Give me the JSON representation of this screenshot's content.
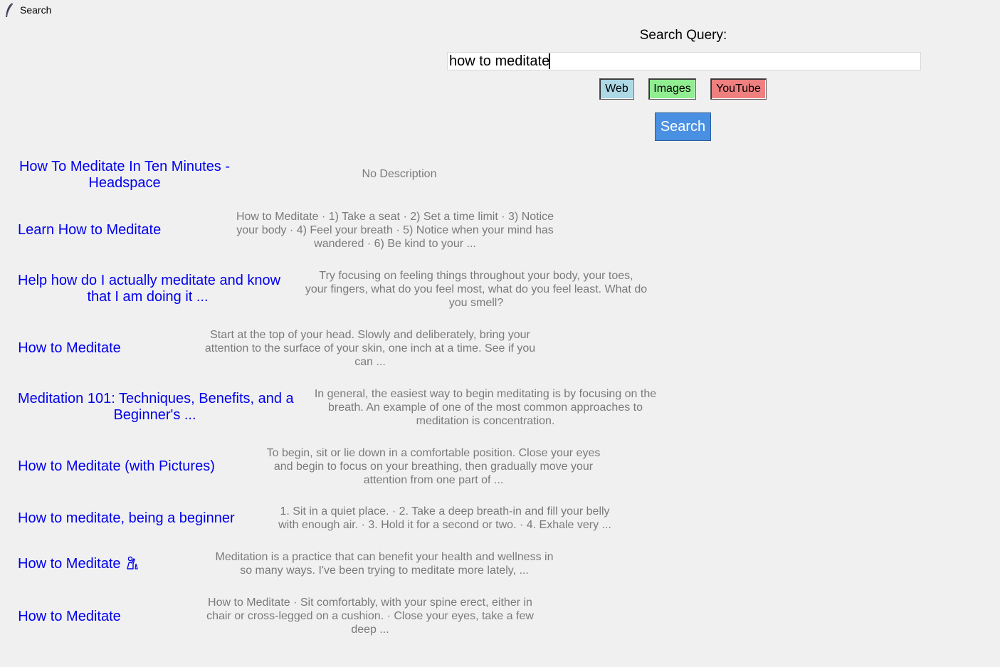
{
  "window": {
    "title": "Search",
    "icon": "feather-icon"
  },
  "search": {
    "label": "Search Query:",
    "value": "how to meditate",
    "search_button": "Search"
  },
  "sources": {
    "web": {
      "label": "Web",
      "color": "#add8e6"
    },
    "images": {
      "label": "Images",
      "color": "#90ee90"
    },
    "youtube": {
      "label": "YouTube",
      "color": "#f08080"
    }
  },
  "colors": {
    "link": "#0000ee",
    "description": "#7a7a7a",
    "search_button": "#4a90e2"
  },
  "results": [
    {
      "title_lines": [
        "How To Meditate In Ten Minutes -",
        "Headspace"
      ],
      "desc_lines": [
        "No Description"
      ]
    },
    {
      "title_lines": [
        "Learn How to Meditate"
      ],
      "desc_lines": [
        "How to Meditate · 1) Take a seat · 2) Set a time limit · 3) Notice",
        "your body · 4) Feel your breath · 5) Notice when your mind has",
        "wandered · 6) Be kind to your ..."
      ]
    },
    {
      "title_lines": [
        "Help how do I actually meditate and know",
        "that I am doing it ..."
      ],
      "desc_lines": [
        "Try focusing on feeling things throughout your body, your toes,",
        "your fingers, what do you feel most, what do you feel least. What do",
        "you smell?"
      ]
    },
    {
      "title_lines": [
        "How to Meditate"
      ],
      "desc_lines": [
        "Start at the top of your head. Slowly and deliberately, bring your",
        "attention to the surface of your skin, one inch at a time. See if you",
        "can ..."
      ]
    },
    {
      "title_lines": [
        "Meditation 101: Techniques, Benefits, and a",
        "Beginner's ..."
      ],
      "desc_lines": [
        "In general, the easiest way to begin meditating is by focusing on the",
        "breath. An example of one of the most common approaches to",
        "meditation is concentration."
      ]
    },
    {
      "title_lines": [
        "How to Meditate (with Pictures)"
      ],
      "desc_lines": [
        "To begin, sit or lie down in a comfortable position. Close your eyes",
        "and begin to focus on your breathing, then gradually move your",
        "attention from one part of ..."
      ]
    },
    {
      "title_lines": [
        "How to meditate, being a beginner"
      ],
      "desc_lines": [
        "1. Sit in a quiet place. · 2. Take a deep breath-in and fill your belly",
        "with enough air. · 3. Hold it for a second or two. · 4. Exhale very ..."
      ]
    },
    {
      "title_lines": [
        "How to Meditate"
      ],
      "title_icon": "praying-person-icon",
      "desc_lines": [
        "Meditation is a practice that can benefit your health and wellness in",
        "so many ways. I've been trying to meditate more lately, ..."
      ]
    },
    {
      "title_lines": [
        "How to Meditate"
      ],
      "desc_lines": [
        "How to Meditate · Sit comfortably, with your spine erect, either in",
        "chair or cross-legged on a cushion. · Close your eyes, take a few",
        "deep ..."
      ]
    }
  ]
}
